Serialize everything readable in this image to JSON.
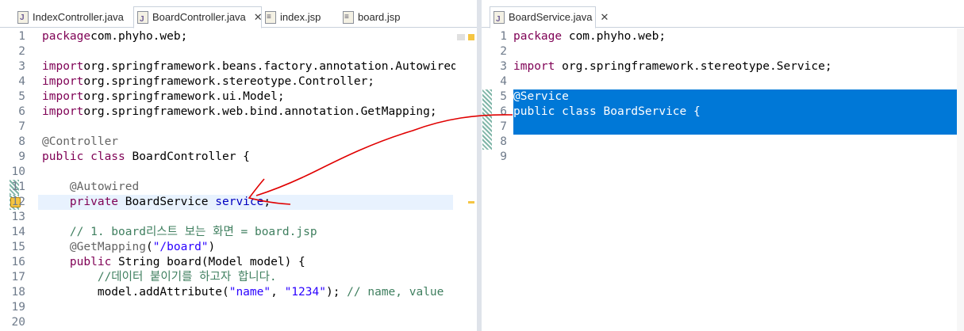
{
  "left_editor": {
    "tabs": [
      {
        "label": "IndexController.java",
        "icon": "java-file-icon"
      },
      {
        "label": "BoardController.java",
        "icon": "java-file-icon",
        "active": true,
        "close": "✕"
      },
      {
        "label": "index.jsp",
        "icon": "jsp-file-icon"
      },
      {
        "label": "board.jsp",
        "icon": "jsp-file-icon"
      }
    ],
    "line_numbers": [
      "1",
      "2",
      "3",
      "4",
      "5",
      "6",
      "7",
      "8",
      "9",
      "10",
      "11",
      "12",
      "13",
      "14",
      "15",
      "16",
      "17",
      "18",
      "19",
      "20"
    ],
    "lines": [
      {
        "parts": [
          [
            "kw",
            "package"
          ],
          [
            "",
            "com.phyho.web;"
          ]
        ]
      },
      {
        "parts": []
      },
      {
        "parts": [
          [
            "kw",
            "import"
          ],
          [
            "",
            "org.springframework.beans.factory.annotation.Autowired;"
          ]
        ]
      },
      {
        "parts": [
          [
            "kw",
            "import"
          ],
          [
            "",
            "org.springframework.stereotype.Controller;"
          ]
        ]
      },
      {
        "parts": [
          [
            "kw",
            "import"
          ],
          [
            "",
            "org.springframework.ui.Model;"
          ]
        ]
      },
      {
        "parts": [
          [
            "kw",
            "import"
          ],
          [
            "",
            "org.springframework.web.bind.annotation.GetMapping;"
          ]
        ]
      },
      {
        "parts": []
      },
      {
        "parts": [
          [
            "ann",
            "@Controller"
          ]
        ]
      },
      {
        "parts": [
          [
            "kw",
            "public"
          ],
          [
            "kw",
            " class"
          ],
          [
            "",
            " BoardController {"
          ]
        ]
      },
      {
        "parts": []
      },
      {
        "parts": [
          [
            "",
            "    "
          ],
          [
            "ann",
            "@Autowired"
          ]
        ]
      },
      {
        "parts": [
          [
            "",
            "    "
          ],
          [
            "kw",
            "private"
          ],
          [
            "",
            " BoardService "
          ],
          [
            "fld",
            "service"
          ],
          [
            "",
            ";"
          ]
        ]
      },
      {
        "parts": []
      },
      {
        "parts": [
          [
            "",
            "    "
          ],
          [
            "cm",
            "// 1. board리스트 보는 화면 = board.jsp"
          ]
        ]
      },
      {
        "parts": [
          [
            "",
            "    "
          ],
          [
            "ann",
            "@GetMapping"
          ],
          [
            "",
            "("
          ],
          [
            "str",
            "\"/board\""
          ],
          [
            "",
            ")"
          ]
        ]
      },
      {
        "parts": [
          [
            "",
            "    "
          ],
          [
            "kw",
            "public"
          ],
          [
            "",
            " String board(Model "
          ],
          [
            "",
            "model) {"
          ]
        ]
      },
      {
        "parts": [
          [
            "",
            "        "
          ],
          [
            "cm",
            "//데이터 붙이기를 하고자 합니다."
          ]
        ]
      },
      {
        "parts": [
          [
            "",
            "        "
          ],
          [
            "",
            "model.addAttribute("
          ],
          [
            "str",
            "\"name\""
          ],
          [
            "",
            ", "
          ],
          [
            "str",
            "\"1234\""
          ],
          [
            "",
            "); "
          ],
          [
            "cm",
            "// name, value"
          ]
        ]
      },
      {
        "parts": []
      },
      {
        "parts": []
      }
    ]
  },
  "right_editor": {
    "tabs": [
      {
        "label": "BoardService.java",
        "icon": "java-file-icon",
        "active": true,
        "close": "✕"
      }
    ],
    "line_numbers": [
      "1",
      "2",
      "3",
      "4",
      "5",
      "6",
      "7",
      "8",
      "9"
    ],
    "lines": [
      {
        "parts": [
          [
            "kw",
            "package"
          ],
          [
            "",
            " com.phyho.web;"
          ]
        ]
      },
      {
        "parts": []
      },
      {
        "parts": [
          [
            "kw",
            "import"
          ],
          [
            "",
            " org.springframework.stereotype.Service;"
          ]
        ]
      },
      {
        "parts": []
      },
      {
        "parts": [
          [
            "ann",
            "@Service"
          ]
        ]
      },
      {
        "parts": [
          [
            "kw",
            "public"
          ],
          [
            "kw",
            " class"
          ],
          [
            "",
            " BoardService {"
          ]
        ]
      },
      {
        "parts": []
      },
      {
        "parts": [
          [
            "",
            "}"
          ]
        ]
      },
      {
        "parts": []
      }
    ]
  },
  "colors": {
    "selection": "#0078d7",
    "keyword": "#7f0055",
    "annotation": "#646464",
    "string": "#2a00ff",
    "comment": "#3f7f5f",
    "field": "#0000c0",
    "current_line": "#e8f2fe",
    "arrow": "#e00000"
  }
}
